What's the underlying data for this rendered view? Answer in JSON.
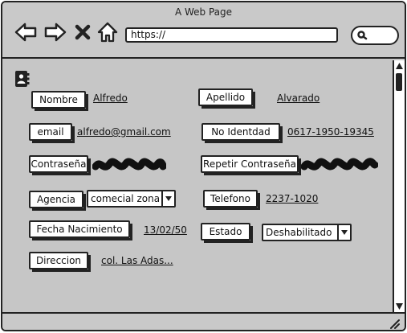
{
  "window": {
    "title": "A Web Page"
  },
  "browser": {
    "url": "https://",
    "nav_icons": [
      "back-arrow-icon",
      "forward-arrow-icon",
      "close-x-icon",
      "home-icon"
    ],
    "search_icon": "search-icon"
  },
  "page": {
    "contact_icon": "address-book-icon",
    "fields": {
      "nombre": {
        "label": "Nombre",
        "value": "Alfredo"
      },
      "apellido": {
        "label": "Apellido",
        "value": "Alvarado"
      },
      "email": {
        "label": "email",
        "value": "alfredo@gmail.com"
      },
      "identidad": {
        "label": "No Identdad",
        "value": "0617-1950-19345"
      },
      "contrasena": {
        "label": "Contraseña",
        "value": ""
      },
      "repetir": {
        "label": "Repetir Contraseña",
        "value": ""
      },
      "agencia": {
        "label": "Agencia",
        "value": "comecial zona"
      },
      "telefono": {
        "label": "Telefono",
        "value": "2237-1020"
      },
      "nacimiento": {
        "label": "Fecha Nacimiento",
        "value": "13/02/50"
      },
      "estado": {
        "label": "Estado",
        "value": "Deshabilitado"
      },
      "direccion": {
        "label": "Direccion",
        "value": "col. Las Adas..."
      }
    }
  },
  "colors": {
    "background": "#c6c6c6",
    "ink": "#222222",
    "field_bg": "#ffffff"
  }
}
